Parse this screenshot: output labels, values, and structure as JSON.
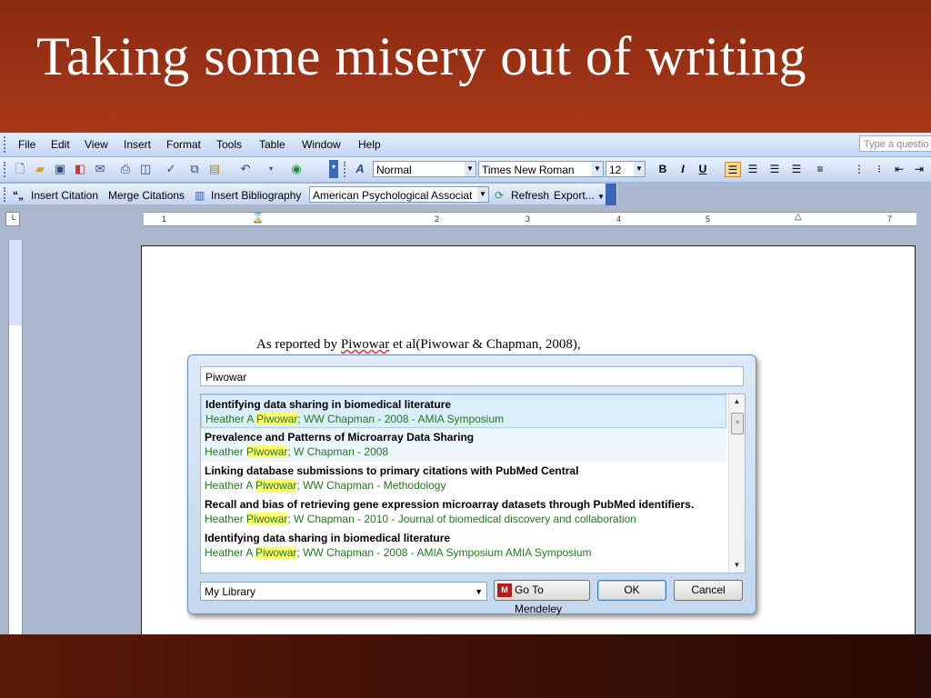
{
  "slide": {
    "title": "Taking some misery out of writing"
  },
  "menubar": {
    "items": [
      "File",
      "Edit",
      "View",
      "Insert",
      "Format",
      "Tools",
      "Table",
      "Window",
      "Help"
    ],
    "help_search_placeholder": "Type a questio"
  },
  "toolbar": {
    "style": "Normal",
    "font": "Times New Roman",
    "size": "12",
    "bold": "B",
    "italic": "I",
    "underline": "U"
  },
  "mendeley_toolbar": {
    "insert_citation": "Insert Citation",
    "merge_citations": "Merge Citations",
    "insert_bibliography": "Insert Bibliography",
    "style": "American Psychological Associat",
    "refresh": "Refresh",
    "export": "Export..."
  },
  "ruler": {
    "labels": [
      "1",
      "2",
      "3",
      "4",
      "5",
      "7"
    ]
  },
  "document": {
    "prefix": "As reported by ",
    "name": "Piwowar",
    "suffix": " et al(Piwowar & Chapman, 2008),"
  },
  "dialog": {
    "search_value": "Piwowar",
    "results": [
      {
        "title": "Identifying data sharing in biomedical literature",
        "meta_pre": "Heather A ",
        "meta_hl": "Piwowar",
        "meta_post": "; WW Chapman - 2008 - AMIA Symposium"
      },
      {
        "title": "Prevalence and Patterns of Microarray Data Sharing",
        "meta_pre": "Heather ",
        "meta_hl": "Piwowar",
        "meta_post": "; W Chapman - 2008"
      },
      {
        "title": "Linking database submissions to primary citations with PubMed Central",
        "meta_pre": "Heather A ",
        "meta_hl": "Piwowar",
        "meta_post": "; WW Chapman - Methodology"
      },
      {
        "title": "Recall and bias of retrieving gene expression microarray datasets through PubMed identifiers.",
        "meta_pre": "Heather ",
        "meta_hl": "Piwowar",
        "meta_post": "; W Chapman - 2010 - Journal of biomedical discovery and collaboration"
      },
      {
        "title": "Identifying data sharing in biomedical literature",
        "meta_pre": "Heather A ",
        "meta_hl": "Piwowar",
        "meta_post": "; WW Chapman - 2008 - AMIA Symposium AMIA Symposium"
      }
    ],
    "library": "My Library",
    "go_to_mendeley": "Go To Mendeley",
    "ok": "OK",
    "cancel": "Cancel"
  },
  "colors": {
    "slide_bg": "#9b3015",
    "highlight": "#ffff70",
    "meta_green": "#1e7a1e",
    "selected_row": "#dbeefb"
  }
}
